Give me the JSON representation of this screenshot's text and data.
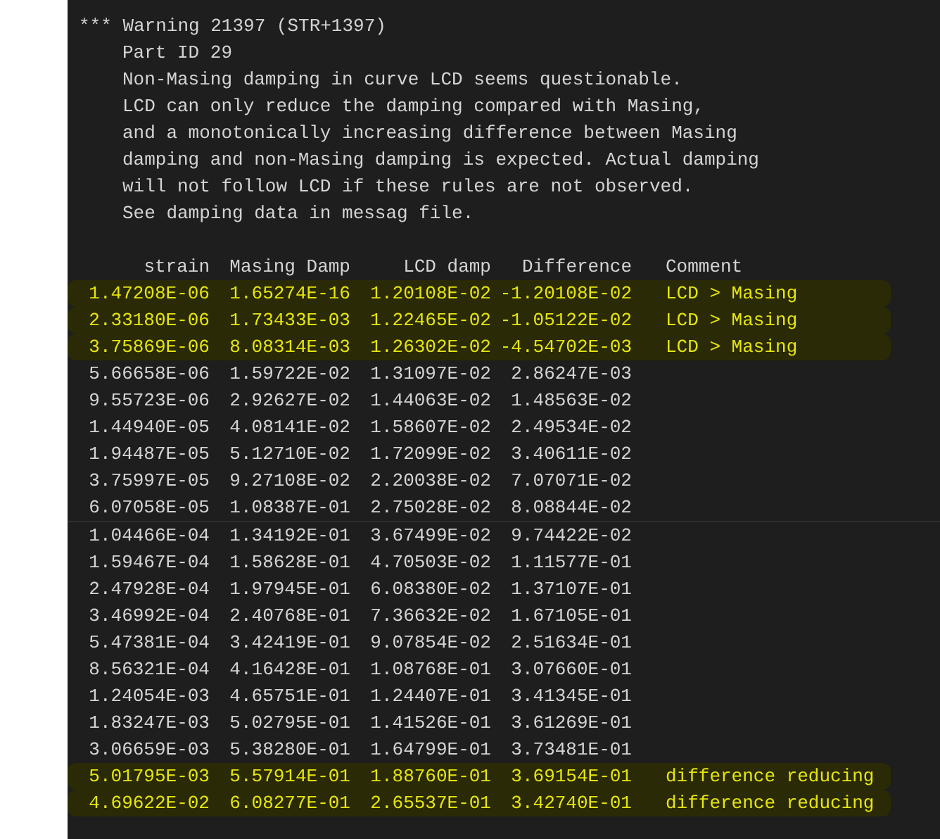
{
  "warning": {
    "heading": "*** Warning 21397 (STR+1397)",
    "lines": [
      "Part ID 29",
      "Non-Masing damping in curve LCD seems questionable.",
      "LCD can only reduce the damping compared with Masing,",
      "and a monotonically increasing difference between Masing",
      "damping and non-Masing damping is expected. Actual damping",
      "will not follow LCD if these rules are not observed.",
      "See damping data in messag file."
    ]
  },
  "table": {
    "columns": [
      "strain",
      "Masing Damp",
      "LCD damp",
      "Difference",
      "Comment"
    ],
    "rows": [
      {
        "cells": [
          "1.47208E-06",
          "1.65274E-16",
          "1.20108E-02",
          "-1.20108E-02"
        ],
        "comment": "LCD > Masing",
        "highlighted": true
      },
      {
        "cells": [
          "2.33180E-06",
          "1.73433E-03",
          "1.22465E-02",
          "-1.05122E-02"
        ],
        "comment": "LCD > Masing",
        "highlighted": true
      },
      {
        "cells": [
          "3.75869E-06",
          "8.08314E-03",
          "1.26302E-02",
          "-4.54702E-03"
        ],
        "comment": "LCD > Masing",
        "highlighted": true
      },
      {
        "cells": [
          "5.66658E-06",
          "1.59722E-02",
          "1.31097E-02",
          "2.86247E-03"
        ],
        "highlighted": false
      },
      {
        "cells": [
          "9.55723E-06",
          "2.92627E-02",
          "1.44063E-02",
          "1.48563E-02"
        ],
        "highlighted": false
      },
      {
        "cells": [
          "1.44940E-05",
          "4.08141E-02",
          "1.58607E-02",
          "2.49534E-02"
        ],
        "highlighted": false
      },
      {
        "cells": [
          "1.94487E-05",
          "5.12710E-02",
          "1.72099E-02",
          "3.40611E-02"
        ],
        "highlighted": false
      },
      {
        "cells": [
          "3.75997E-05",
          "9.27108E-02",
          "2.20038E-02",
          "7.07071E-02"
        ],
        "highlighted": false
      },
      {
        "cells": [
          "6.07058E-05",
          "1.08387E-01",
          "2.75028E-02",
          "8.08844E-02"
        ],
        "highlighted": false
      },
      {
        "cells": [
          "1.04466E-04",
          "1.34192E-01",
          "3.67499E-02",
          "9.74422E-02"
        ],
        "highlighted": false
      },
      {
        "cells": [
          "1.59467E-04",
          "1.58628E-01",
          "4.70503E-02",
          "1.11577E-01"
        ],
        "highlighted": false
      },
      {
        "cells": [
          "2.47928E-04",
          "1.97945E-01",
          "6.08380E-02",
          "1.37107E-01"
        ],
        "highlighted": false
      },
      {
        "cells": [
          "3.46992E-04",
          "2.40768E-01",
          "7.36632E-02",
          "1.67105E-01"
        ],
        "highlighted": false
      },
      {
        "cells": [
          "5.47381E-04",
          "3.42419E-01",
          "9.07854E-02",
          "2.51634E-01"
        ],
        "highlighted": false
      },
      {
        "cells": [
          "8.56321E-04",
          "4.16428E-01",
          "1.08768E-01",
          "3.07660E-01"
        ],
        "highlighted": false
      },
      {
        "cells": [
          "1.24054E-03",
          "4.65751E-01",
          "1.24407E-01",
          "3.41345E-01"
        ],
        "highlighted": false
      },
      {
        "cells": [
          "1.83247E-03",
          "5.02795E-01",
          "1.41526E-01",
          "3.61269E-01"
        ],
        "highlighted": false
      },
      {
        "cells": [
          "3.06659E-03",
          "5.38280E-01",
          "1.64799E-01",
          "3.73481E-01"
        ],
        "highlighted": false
      },
      {
        "cells": [
          "5.01795E-03",
          "5.57914E-01",
          "1.88760E-01",
          "3.69154E-01"
        ],
        "comment": "difference reducing",
        "highlighted": true
      },
      {
        "cells": [
          "4.69622E-02",
          "6.08277E-01",
          "2.65537E-01",
          "3.42740E-01"
        ],
        "comment": "difference reducing",
        "highlighted": true
      }
    ]
  }
}
